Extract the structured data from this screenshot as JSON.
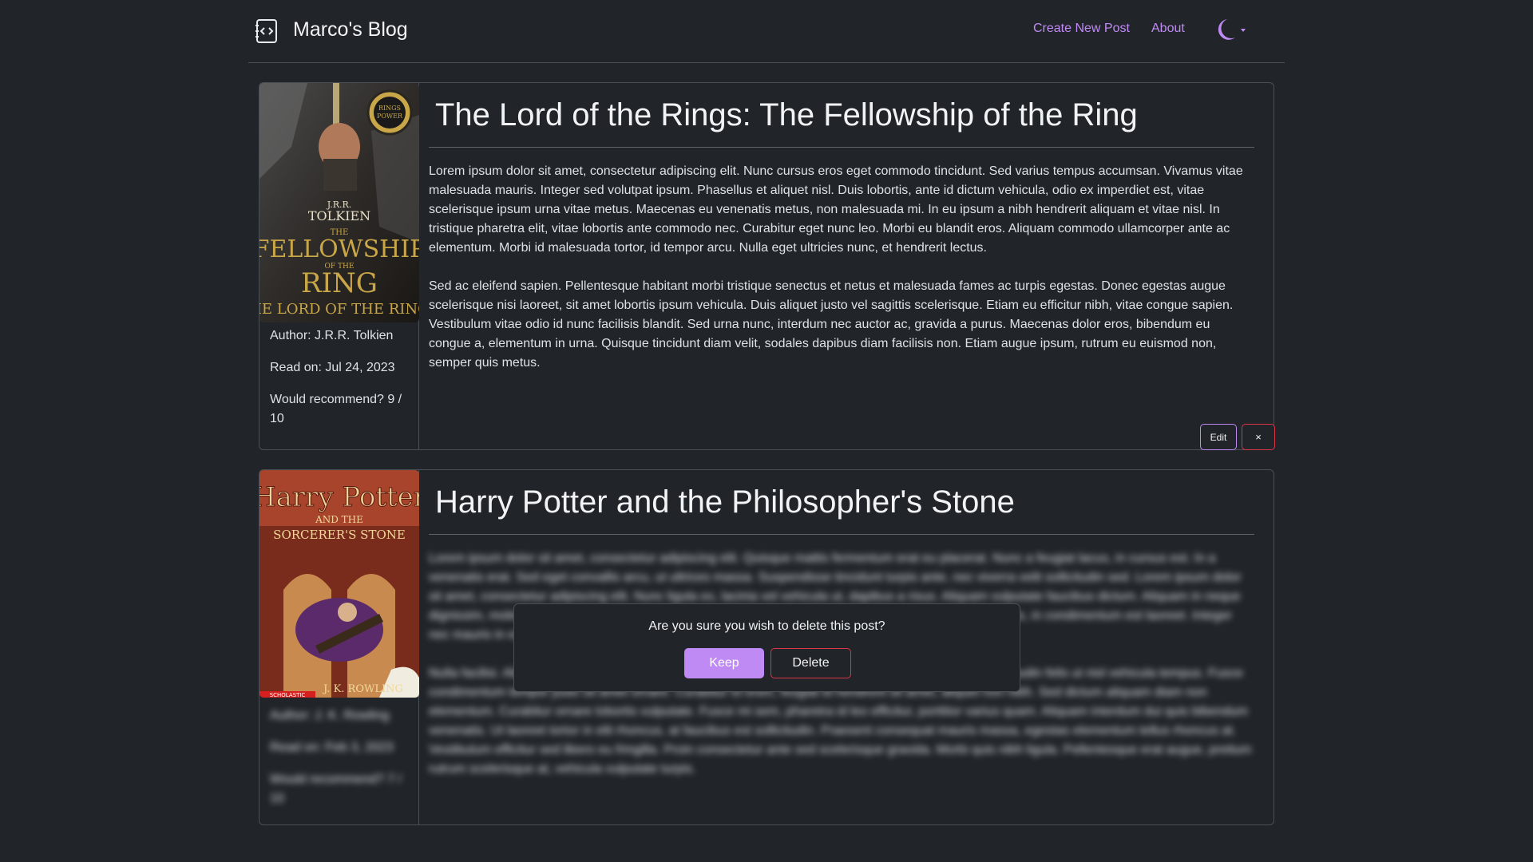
{
  "header": {
    "brand": "Marco's Blog",
    "nav": {
      "create_new_post": "Create New Post",
      "about": "About"
    },
    "theme_icon": "moon-icon"
  },
  "posts": [
    {
      "title": "The Lord of the Rings: The Fellowship of the Ring",
      "cover": {
        "author_text": "J.R.R. TOLKIEN",
        "title_lines": [
          "THE",
          "FELLOWSHIP",
          "OF THE",
          "RING"
        ],
        "series": "THE LORD OF THE RINGS",
        "seal": "THE RINGS OF POWER"
      },
      "author": "Author: J.R.R. Tolkien",
      "read_on": "Read on: Jul 24, 2023",
      "recommend": "Would recommend? 9 / 10",
      "paragraphs": [
        "Lorem ipsum dolor sit amet, consectetur adipiscing elit. Nunc cursus eros eget commodo tincidunt. Sed varius tempus accumsan. Vivamus vitae malesuada mauris. Integer sed volutpat ipsum. Phasellus et aliquet nisl. Duis lobortis, ante id dictum vehicula, odio ex imperdiet est, vitae scelerisque ipsum urna vitae metus. Maecenas eu venenatis metus, non malesuada mi. In eu ipsum a nibh hendrerit aliquam et vitae nisl. In tristique pharetra elit, vitae lobortis ante commodo nec. Curabitur eget nunc leo. Morbi eu blandit eros. Aliquam commodo ullamcorper ante ac elementum. Morbi id malesuada tortor, id tempor arcu. Nulla eget ultricies nunc, et hendrerit lectus.",
        "Sed ac eleifend sapien. Pellentesque habitant morbi tristique senectus et netus et malesuada fames ac turpis egestas. Donec egestas augue scelerisque nisi laoreet, sit amet lobortis ipsum vehicula. Duis aliquet justo vel sagittis scelerisque. Etiam eu efficitur nibh, vitae congue sapien. Vestibulum vitae odio id nunc facilisis blandit. Sed urna nunc, interdum nec auctor ac, gravida a purus. Maecenas dolor eros, bibendum eu congue a, elementum in urna. Quisque tincidunt diam velit, sodales dapibus diam facilisis non. Etiam augue ipsum, rutrum eu euismod non, semper quis metus."
      ],
      "edit_label": "Edit",
      "close_label": "×"
    },
    {
      "title": "Harry Potter and the Philosopher's Stone",
      "cover": {
        "title_line1": "Harry Potter",
        "title_line2": "AND THE",
        "title_line3": "SORCERER'S STONE",
        "author_text": "J. K. ROWLING",
        "publisher": "SCHOLASTIC"
      },
      "author": "Author: J. K. Rowling",
      "read_on": "Read on: Feb 3, 2023",
      "recommend": "Would recommend? 7 / 10",
      "paragraphs": [
        "Lorem ipsum dolor sit amet, consectetur adipiscing elit. Quisque mattis fermentum erat eu placerat. Nunc a feugiat lacus, in cursus est. In a venenatis erat. Sed eget convallis arcu, ut ultrices massa. Suspendisse tincidunt turpis ante, nec viverra velit sollicitudin sed. Lorem ipsum dolor sit amet, consectetur adipiscing elit. Nunc ligula ex, lacinia vel vehicula ut, dapibus a risus. Aliquam vulputate faucibus dictum. Aliquam in neque dignissim, molestie lacus sed, varius nisi. Donec lobortis nibh vitae est ultricies, nec imperdiet lacus turpis, in condimentum est laoreet. Integer nec mauris in est commodo sodales. Sed congue lectus quam eget ligula.",
        "Nulla facilisi. Aliquam erat volutpat. Curabitur vel eros ac dolor luctus efficitur vel quis augue. Duis sollicitudin felis ut nisl vehicula tempus. Fusce condimentum tempor justo sit amet ornare. Curabitur et enim, feugiat id hendrerit sit amet, aliquet non nibh. Sed dictum aliquam diam non elementum. Curabitur ornare lobortis vulputate. Fusce mi sem, pharetra id leo efficitur, porttitor varius quam. Aliquam interdum dui quis bibendum venenatis. Ut laoreet tortor in elit rhoncus, at faucibus est sollicitudin. Praesent consequat mauris massa, egestas elementum tellus rhoncus at. Vestibulum efficitur sed libero eu fringilla. Proin consectetur ante sed scelerisque gravida. Morbi quis nibh ligula. Pellentesque erat augue, pretium rutrum scelerisque at, vehicula vulputate turpis."
      ]
    }
  ],
  "dialog": {
    "message": "Are you sure you wish to delete this post?",
    "keep_label": "Keep",
    "delete_label": "Delete"
  },
  "colors": {
    "background": "#212529",
    "accent": "#c08af5",
    "danger": "#dc3545",
    "border": "#495057"
  }
}
